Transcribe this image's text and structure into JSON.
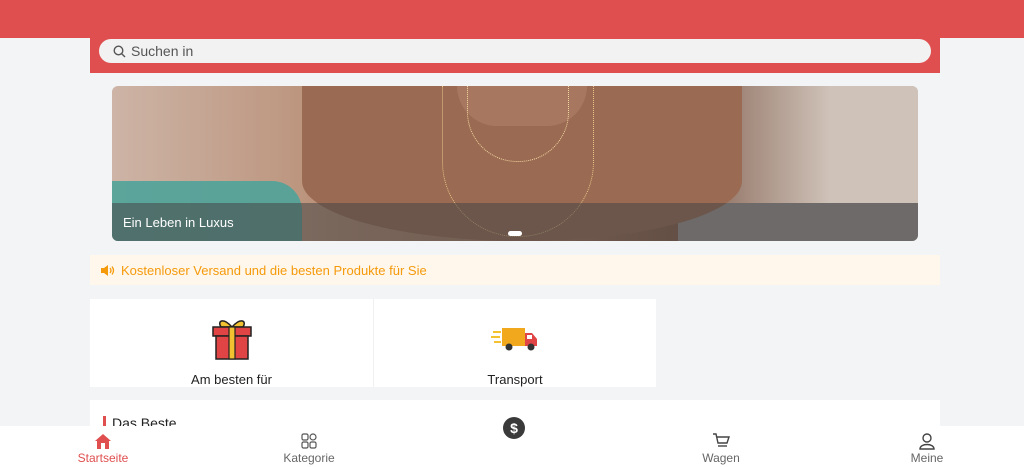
{
  "header": {
    "accent_color": "#e04f4f"
  },
  "search": {
    "placeholder": "Suchen in",
    "icon": "search-icon"
  },
  "banner": {
    "caption": "Ein Leben in Luxus",
    "slide_count": 1,
    "active_slide": 1
  },
  "notice": {
    "icon": "speaker-icon",
    "text": "Kostenloser Versand und die besten Produkte für Sie",
    "color": "#f59a0b"
  },
  "categories": [
    {
      "label": "Am besten für",
      "icon": "gift-icon"
    },
    {
      "label": "Transport",
      "icon": "delivery-truck-icon"
    }
  ],
  "section": {
    "title": "Das Beste"
  },
  "tabbar": {
    "items": [
      {
        "label": "Startseite",
        "icon": "home-icon",
        "active": true
      },
      {
        "label": "Kategorie",
        "icon": "grid-icon",
        "active": false
      },
      {
        "label": "",
        "icon": "dollar-icon",
        "active": false,
        "glyph": "$"
      },
      {
        "label": "Wagen",
        "icon": "cart-icon",
        "active": false
      },
      {
        "label": "Meine",
        "icon": "user-icon",
        "active": false
      }
    ]
  }
}
